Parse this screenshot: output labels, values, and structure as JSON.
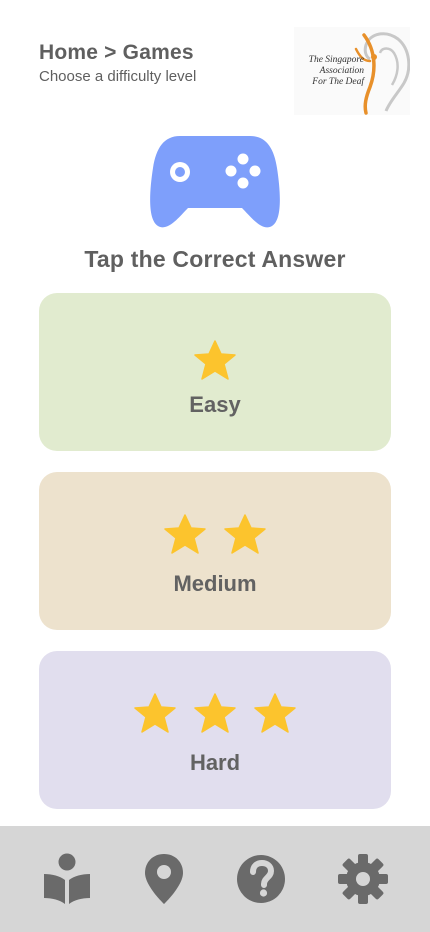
{
  "header": {
    "breadcrumb": "Home > Games",
    "subtitle": "Choose a difficulty level"
  },
  "logo": {
    "line1": "The Singapore",
    "line2": "Association",
    "line3": "For The Deaf",
    "icon": "ear-logo-icon"
  },
  "hero": {
    "icon": "gamepad-icon",
    "title": "Tap the Correct Answer"
  },
  "levels": [
    {
      "label": "Easy",
      "stars": 1,
      "color": "#e1ebcf"
    },
    {
      "label": "Medium",
      "stars": 2,
      "color": "#ede2cd"
    },
    {
      "label": "Hard",
      "stars": 3,
      "color": "#e1deee"
    }
  ],
  "bottom_nav": [
    {
      "icon": "book-reader-icon"
    },
    {
      "icon": "map-pin-icon"
    },
    {
      "icon": "help-circle-icon"
    },
    {
      "icon": "gear-icon"
    }
  ],
  "colors": {
    "star": "#fcc42d",
    "gamepad": "#7e9ffb",
    "nav_bar": "#d6d6d6",
    "nav_icon": "#6a6a6a",
    "logo_orange": "#e8902a"
  }
}
